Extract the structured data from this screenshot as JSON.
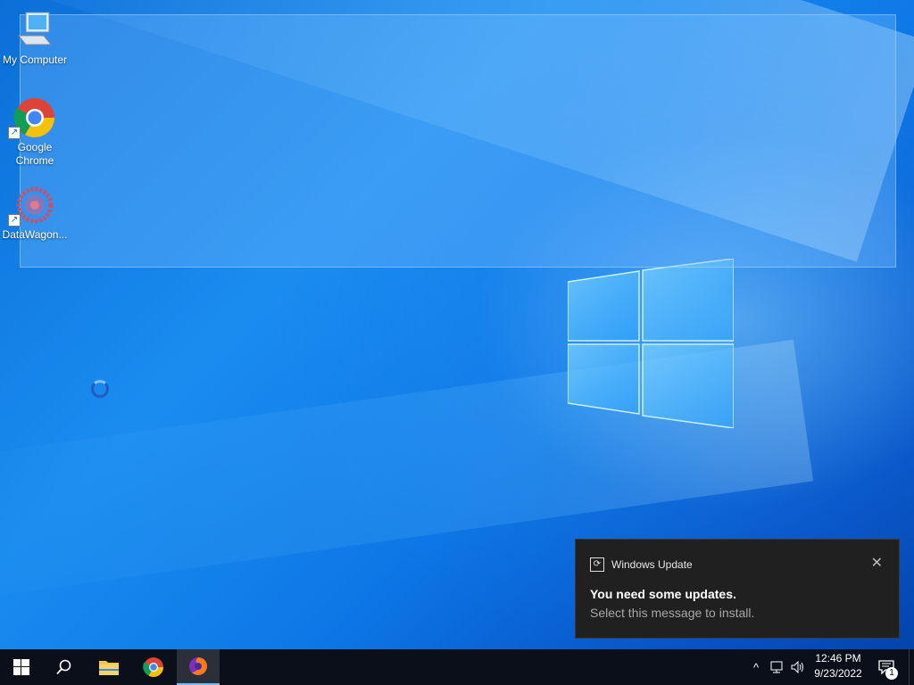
{
  "desktop": {
    "icons": [
      {
        "label": "My Computer",
        "icon": "computer-icon"
      },
      {
        "label": "Google Chrome",
        "icon": "chrome-icon"
      },
      {
        "label": "DataWagon...",
        "icon": "datawagon-icon"
      }
    ],
    "wallpaper": "windows-10-hero",
    "accent": "#1a8cf0"
  },
  "toast": {
    "app": "Windows Update",
    "app_icon": "refresh-icon",
    "close": "✕",
    "title": "You need some updates.",
    "body": "Select this message to install."
  },
  "taskbar": {
    "start_icon": "windows-start-icon",
    "search_icon": "search-icon",
    "pinned": [
      {
        "name": "File Explorer",
        "icon": "folder-icon"
      },
      {
        "name": "Google Chrome",
        "icon": "chrome-icon"
      },
      {
        "name": "Firefox",
        "icon": "firefox-icon",
        "active": true
      }
    ],
    "tray": {
      "chevron": "^",
      "time": "12:46 PM",
      "date": "9/23/2022",
      "notifications": "1"
    }
  }
}
